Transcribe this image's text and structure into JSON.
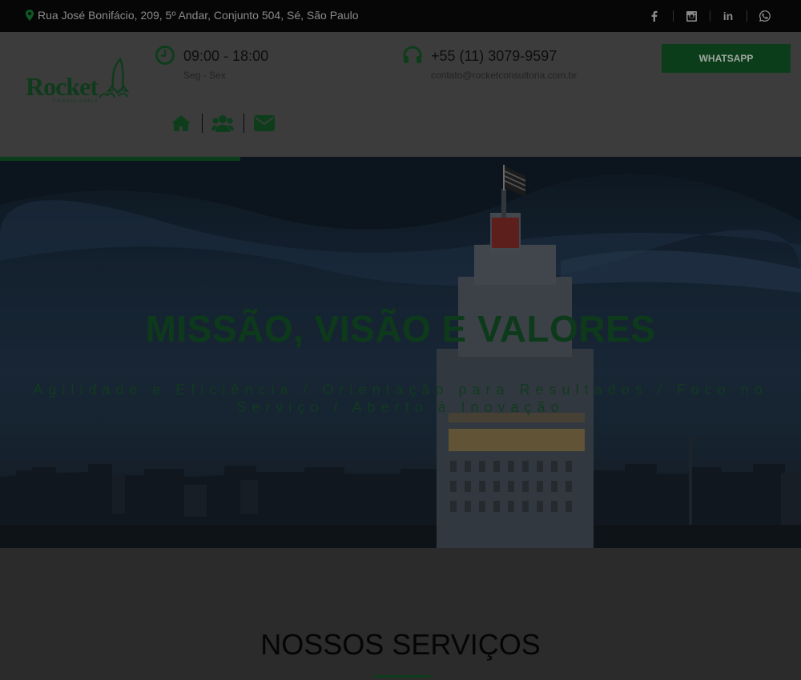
{
  "topbar": {
    "address": "Rua José Bonifácio, 209, 5º Andar, Conjunto 504, Sé, São Paulo",
    "social": [
      "facebook-icon",
      "instagram-icon",
      "linkedin-icon",
      "whatsapp-icon"
    ],
    "linkedin_label": "in"
  },
  "header": {
    "logo_text": "Rocket",
    "logo_sub": "CONSULTORIA",
    "hours": {
      "time": "09:00 - 18:00",
      "days": "Seg - Sex"
    },
    "contact": {
      "phone": "+55 (11) 3079-9597",
      "email": "contato@rocketconsultoria.com.br"
    },
    "whatsapp_label": "WHATSAPP",
    "nav_icons": [
      "home-icon",
      "users-icon",
      "envelope-icon"
    ]
  },
  "hero": {
    "title": "MISSÃO, VISÃO E VALORES",
    "subtitle": "Agilidade e Eficiência / Orientação para Resultados / Foco no Serviço / Aberto à Inovação"
  },
  "services": {
    "title": "NOSSOS SERVIÇOS"
  },
  "colors": {
    "brand_green": "#0c3d1b",
    "topbar": "#060606",
    "overlay": "#3c3c3c"
  }
}
